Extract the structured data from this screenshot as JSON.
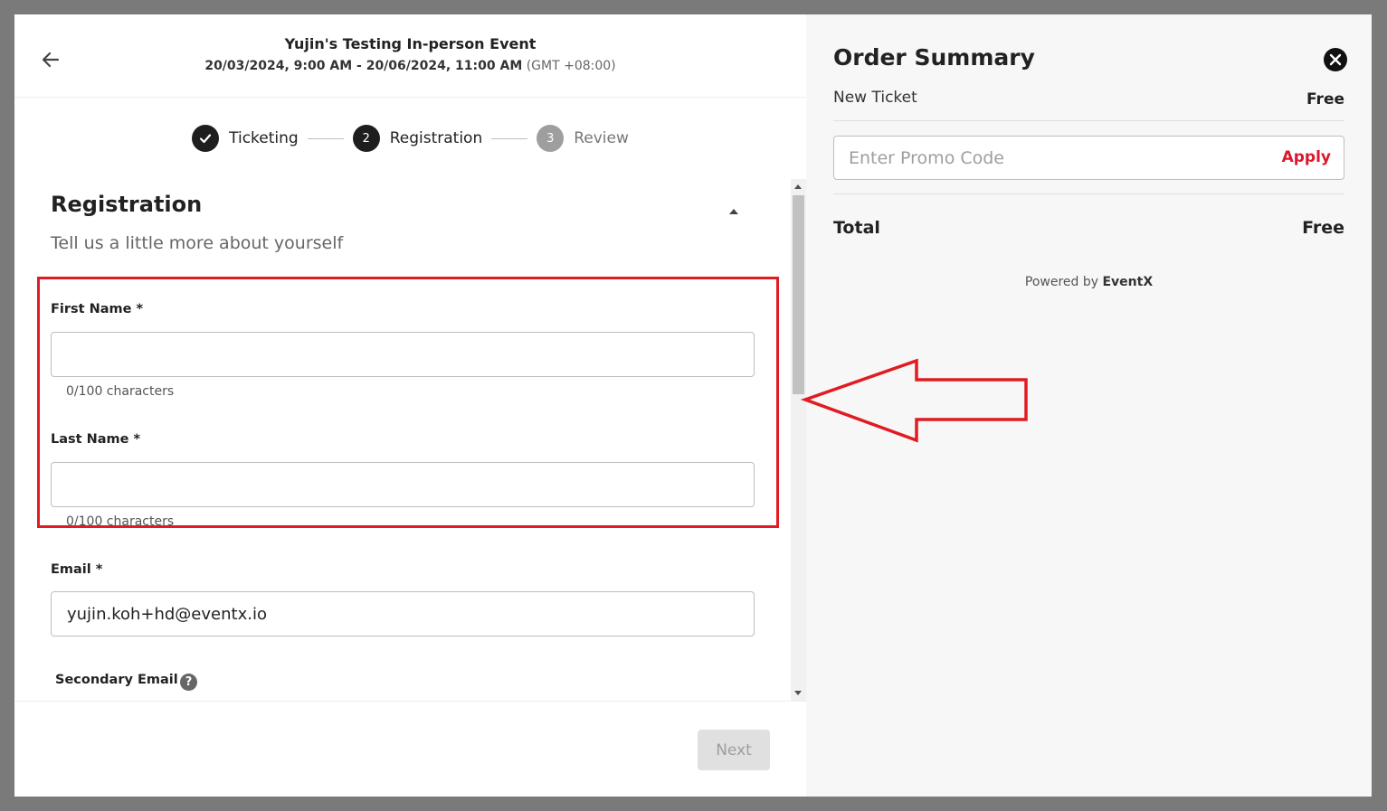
{
  "event": {
    "title": "Yujin's Testing In-person Event",
    "date_range": "20/03/2024, 9:00 AM - 20/06/2024, 11:00 AM",
    "timezone": "(GMT +08:00)"
  },
  "stepper": {
    "steps": [
      {
        "number": "",
        "label": "Ticketing",
        "state": "done"
      },
      {
        "number": "2",
        "label": "Registration",
        "state": "active"
      },
      {
        "number": "3",
        "label": "Review",
        "state": "pending"
      }
    ]
  },
  "form": {
    "title": "Registration",
    "subtitle": "Tell us a little more about yourself",
    "fields": {
      "first_name": {
        "label": "First Name *",
        "value": "",
        "helper": "0/100 characters"
      },
      "last_name": {
        "label": "Last Name *",
        "value": "",
        "helper": "0/100 characters"
      },
      "email": {
        "label": "Email *",
        "value": "yujin.koh+hd@eventx.io"
      },
      "secondary_email": {
        "label": "Secondary Email",
        "help_icon": "?"
      }
    }
  },
  "footer": {
    "next_label": "Next"
  },
  "order_summary": {
    "title": "Order Summary",
    "ticket": {
      "name": "New Ticket",
      "price": "Free"
    },
    "promo": {
      "placeholder": "Enter Promo Code",
      "apply_label": "Apply"
    },
    "total": {
      "label": "Total",
      "value": "Free"
    },
    "powered_by": {
      "prefix": "Powered by",
      "brand": "EventX"
    }
  },
  "colors": {
    "accent_red": "#d9182d",
    "annotation_red": "#e11b22",
    "step_active": "#1e1e1e",
    "step_pending": "#9e9e9e"
  }
}
